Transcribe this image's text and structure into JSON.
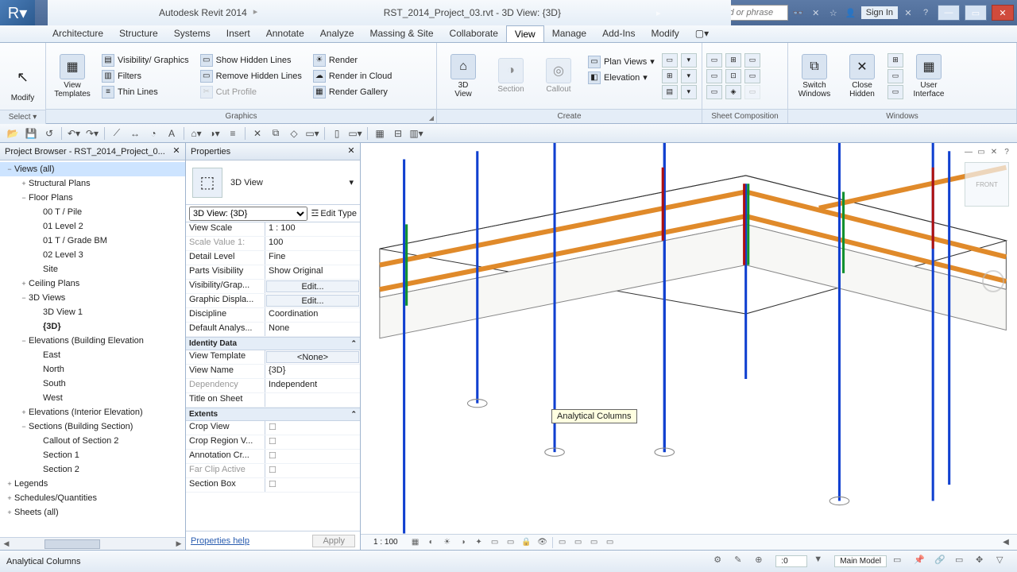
{
  "app": {
    "title": "Autodesk Revit 2014",
    "document": "RST_2014_Project_03.rvt - 3D View: {3D}",
    "search_placeholder": "Type a keyword or phrase",
    "signin": "Sign In"
  },
  "ribbon": {
    "tabs": [
      "Architecture",
      "Structure",
      "Systems",
      "Insert",
      "Annotate",
      "Analyze",
      "Massing & Site",
      "Collaborate",
      "View",
      "Manage",
      "Add-Ins",
      "Modify"
    ],
    "active_tab": "View",
    "select": {
      "modify": "Modify",
      "panel": "Select ▾"
    },
    "panels": {
      "graphics": {
        "title": "Graphics",
        "view_templates": "View\nTemplates",
        "visibility_graphics": "Visibility/ Graphics",
        "filters": "Filters",
        "thin_lines": "Thin Lines",
        "show_hidden": "Show Hidden Lines",
        "remove_hidden": "Remove Hidden Lines",
        "cut_profile": "Cut Profile",
        "render": "Render",
        "render_cloud": "Render in Cloud",
        "render_gallery": "Render Gallery"
      },
      "create": {
        "title": "Create",
        "3d_view": "3D\nView",
        "section": "Section",
        "callout": "Callout",
        "plan_views": "Plan Views",
        "elevation": "Elevation"
      },
      "sheet": {
        "title": "Sheet Composition"
      },
      "windows": {
        "title": "Windows",
        "switch": "Switch\nWindows",
        "close_hidden": "Close\nHidden",
        "ui": "User\nInterface"
      }
    }
  },
  "browser": {
    "title": "Project Browser - RST_2014_Project_0...",
    "tree": [
      {
        "d": 0,
        "tw": "−",
        "t": "Views (all)",
        "sel": true
      },
      {
        "d": 1,
        "tw": "+",
        "t": "Structural Plans"
      },
      {
        "d": 1,
        "tw": "−",
        "t": "Floor Plans"
      },
      {
        "d": 2,
        "tw": "",
        "t": "00 T / Pile"
      },
      {
        "d": 2,
        "tw": "",
        "t": "01 Level 2"
      },
      {
        "d": 2,
        "tw": "",
        "t": "01 T / Grade BM"
      },
      {
        "d": 2,
        "tw": "",
        "t": "02 Level 3"
      },
      {
        "d": 2,
        "tw": "",
        "t": "Site"
      },
      {
        "d": 1,
        "tw": "+",
        "t": "Ceiling Plans"
      },
      {
        "d": 1,
        "tw": "−",
        "t": "3D Views"
      },
      {
        "d": 2,
        "tw": "",
        "t": "3D View 1"
      },
      {
        "d": 2,
        "tw": "",
        "t": "{3D}",
        "bold": true
      },
      {
        "d": 1,
        "tw": "−",
        "t": "Elevations (Building Elevation"
      },
      {
        "d": 2,
        "tw": "",
        "t": "East"
      },
      {
        "d": 2,
        "tw": "",
        "t": "North"
      },
      {
        "d": 2,
        "tw": "",
        "t": "South"
      },
      {
        "d": 2,
        "tw": "",
        "t": "West"
      },
      {
        "d": 1,
        "tw": "+",
        "t": "Elevations (Interior Elevation)"
      },
      {
        "d": 1,
        "tw": "−",
        "t": "Sections (Building Section)"
      },
      {
        "d": 2,
        "tw": "",
        "t": "Callout of Section 2"
      },
      {
        "d": 2,
        "tw": "",
        "t": "Section 1"
      },
      {
        "d": 2,
        "tw": "",
        "t": "Section 2"
      },
      {
        "d": 0,
        "tw": "+",
        "t": "Legends"
      },
      {
        "d": 0,
        "tw": "+",
        "t": "Schedules/Quantities"
      },
      {
        "d": 0,
        "tw": "+",
        "t": "Sheets (all)"
      }
    ]
  },
  "properties": {
    "title": "Properties",
    "type": "3D View",
    "selector": "3D View: {3D}",
    "edit_type": "Edit Type",
    "rows": [
      {
        "k": "View Scale",
        "v": "1 : 100"
      },
      {
        "k": "Scale Value   1:",
        "v": "100",
        "dim": true
      },
      {
        "k": "Detail Level",
        "v": "Fine"
      },
      {
        "k": "Parts Visibility",
        "v": "Show Original"
      },
      {
        "k": "Visibility/Grap...",
        "v": "Edit...",
        "btn": true
      },
      {
        "k": "Graphic Displa...",
        "v": "Edit...",
        "btn": true
      },
      {
        "k": "Discipline",
        "v": "Coordination"
      },
      {
        "k": "Default Analys...",
        "v": "None"
      }
    ],
    "cat_identity": "Identity Data",
    "rows2": [
      {
        "k": "View Template",
        "v": "<None>",
        "btn": true
      },
      {
        "k": "View Name",
        "v": "{3D}"
      },
      {
        "k": "Dependency",
        "v": "Independent",
        "dim": true
      },
      {
        "k": "Title on Sheet",
        "v": ""
      }
    ],
    "cat_extents": "Extents",
    "rows3": [
      {
        "k": "Crop View",
        "v": "",
        "chk": true
      },
      {
        "k": "Crop Region V...",
        "v": "",
        "chk": true
      },
      {
        "k": "Annotation Cr...",
        "v": "",
        "chk": true
      },
      {
        "k": "Far Clip Active",
        "v": "",
        "chk": true,
        "dim": true
      },
      {
        "k": "Section Box",
        "v": "",
        "chk": true
      }
    ],
    "help": "Properties help",
    "apply": "Apply"
  },
  "canvas": {
    "tooltip": "Analytical Columns",
    "scale": "1 : 100"
  },
  "status": {
    "left": "Analytical Columns",
    "val": ":0",
    "model": "Main Model"
  }
}
